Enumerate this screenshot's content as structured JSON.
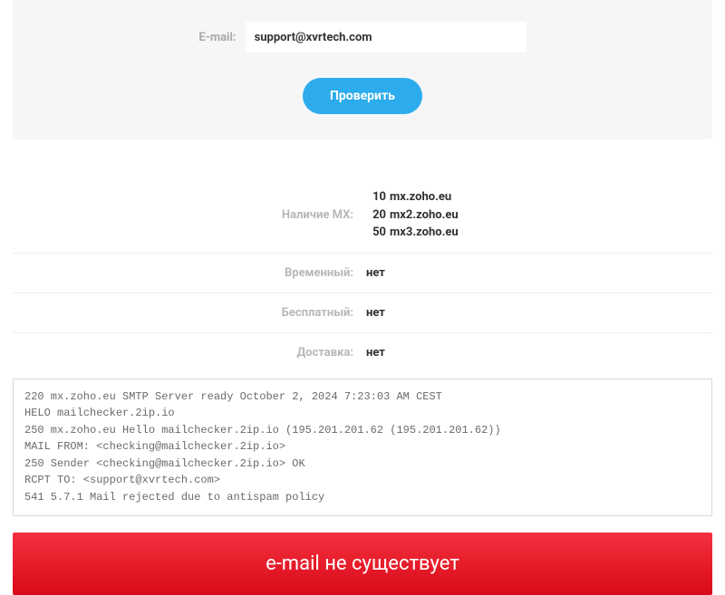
{
  "form": {
    "email_label": "E-mail:",
    "email_value": "support@xvrtech.com",
    "submit_label": "Проверить"
  },
  "results": {
    "mx": {
      "label": "Наличие MX:",
      "records": [
        {
          "priority": "10",
          "host": "mx.zoho.eu"
        },
        {
          "priority": "20",
          "host": "mx2.zoho.eu"
        },
        {
          "priority": "50",
          "host": "mx3.zoho.eu"
        }
      ]
    },
    "temporary": {
      "label": "Временный:",
      "value": "нет"
    },
    "free": {
      "label": "Бесплатный:",
      "value": "нет"
    },
    "delivery": {
      "label": "Доставка:",
      "value": "нет"
    }
  },
  "smtp_log": "220 mx.zoho.eu SMTP Server ready October 2, 2024 7:23:03 AM CEST\nHELO mailchecker.2ip.io\n250 mx.zoho.eu Hello mailchecker.2ip.io (195.201.201.62 (195.201.201.62))\nMAIL FROM: <checking@mailchecker.2ip.io>\n250 Sender <checking@mailchecker.2ip.io> OK\nRCPT TO: <support@xvrtech.com>\n541 5.7.1 Mail rejected due to antispam policy",
  "status_banner": "e-mail не существует",
  "colors": {
    "button": "#2cacec",
    "banner_top": "#f4313f",
    "banner_bottom": "#d90a18"
  }
}
